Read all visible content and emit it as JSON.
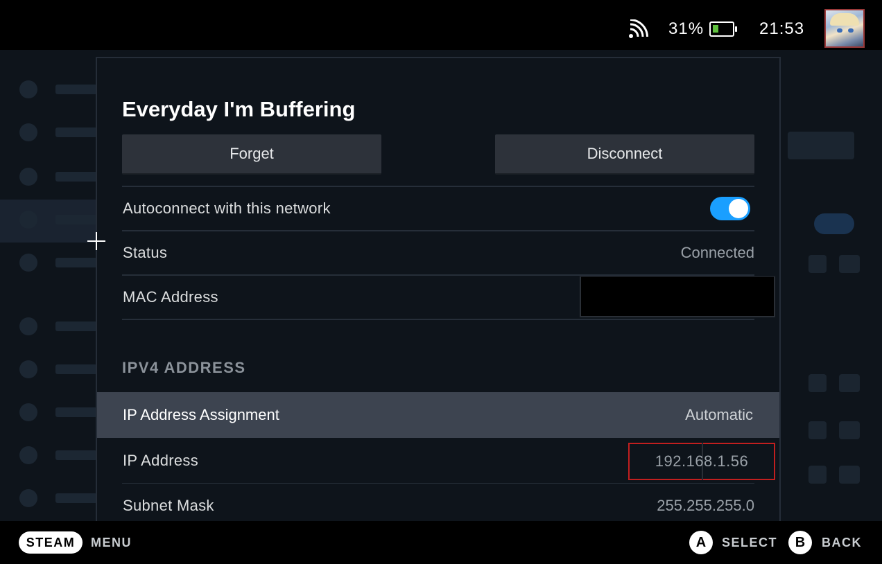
{
  "status_bar": {
    "battery_percent": "31%",
    "battery_level": 0.31,
    "clock": "21:53",
    "icons": [
      "wifi-icon",
      "battery-icon",
      "avatar"
    ]
  },
  "dialog": {
    "title": "Everyday I'm Buffering",
    "buttons": {
      "forget": "Forget",
      "disconnect": "Disconnect"
    },
    "rows": {
      "autoconnect": {
        "label": "Autoconnect with this network",
        "toggle_on": true
      },
      "status": {
        "label": "Status",
        "value": "Connected"
      },
      "mac": {
        "label": "MAC Address",
        "value_redacted": true
      }
    },
    "ipv4_section": "IPV4 ADDRESS",
    "ipv4": {
      "assignment": {
        "label": "IP Address Assignment",
        "value": "Automatic"
      },
      "ip": {
        "label": "IP Address",
        "value": "192.168.1.56"
      },
      "subnet": {
        "label": "Subnet Mask",
        "value": "255.255.255.0"
      }
    }
  },
  "footer": {
    "steam": "STEAM",
    "menu": "MENU",
    "a_glyph": "A",
    "a_label": "SELECT",
    "b_glyph": "B",
    "b_label": "BACK"
  },
  "colors": {
    "accent": "#1a9fff",
    "highlight_row": "#3d4450",
    "ip_box_border": "#c21f1f",
    "battery_fill": "#5fc03e"
  }
}
